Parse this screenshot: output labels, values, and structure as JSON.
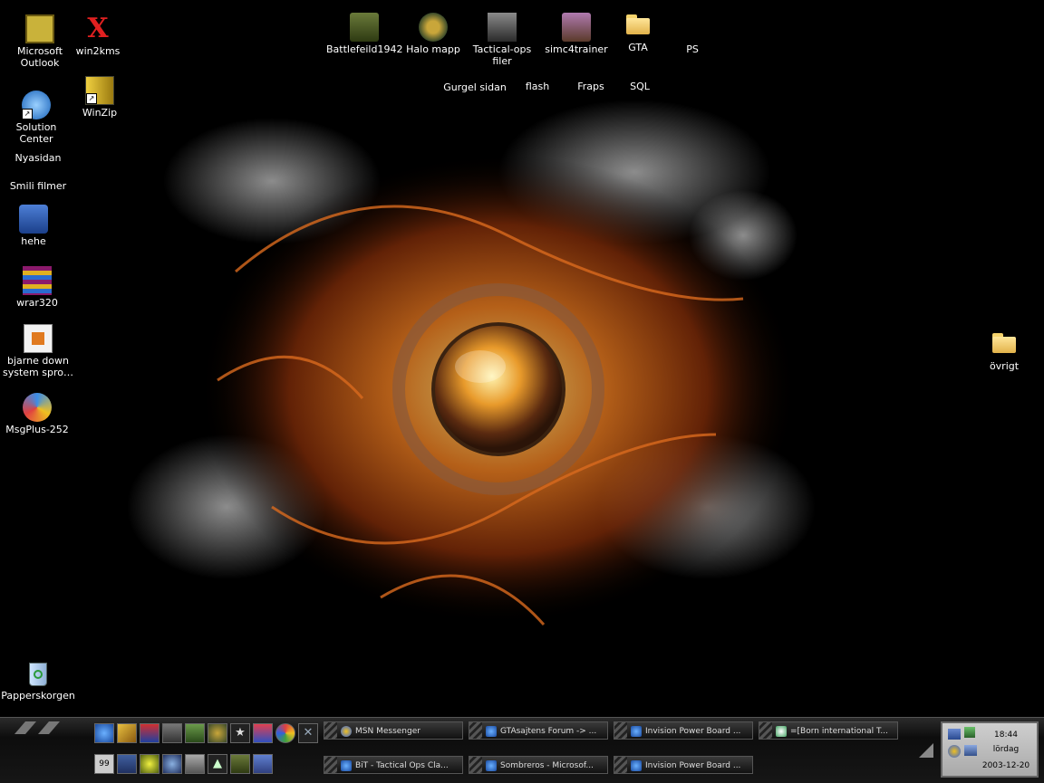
{
  "desktop": {
    "left_column": [
      {
        "label": "Microsoft Outlook",
        "icon": "outlook-icon"
      },
      {
        "label": "Solution Center",
        "icon": "dell-icon"
      },
      {
        "label": "Nyasidan",
        "icon": ""
      },
      {
        "label": "Smili filmer",
        "icon": ""
      },
      {
        "label": "hehe",
        "icon": "psd-icon"
      },
      {
        "label": "wrar320",
        "icon": "winrar-icon"
      },
      {
        "label": "bjarne down system spro…",
        "icon": "document-icon"
      },
      {
        "label": "MsgPlus-252",
        "icon": "msgplus-icon"
      }
    ],
    "second_column": [
      {
        "label": "win2kms",
        "icon": "x-icon"
      },
      {
        "label": "WinZip",
        "icon": "winzip-icon"
      }
    ],
    "top_row": [
      {
        "label": "Battlefeild1942",
        "icon": "battlefield-icon"
      },
      {
        "label": "Halo mapp",
        "icon": "halo-icon"
      },
      {
        "label": "Tactical-ops filer",
        "icon": "tactical-icon"
      },
      {
        "label": "simc4trainer",
        "icon": "trainer-icon"
      },
      {
        "label": "GTA",
        "icon": "folder-icon"
      },
      {
        "label": "PS",
        "icon": ""
      }
    ],
    "second_row": [
      {
        "label": "Gurgel sidan"
      },
      {
        "label": "flash"
      },
      {
        "label": "Fraps"
      },
      {
        "label": "SQL"
      }
    ],
    "recycle": {
      "label": "Papperskorgen"
    },
    "right_folder": {
      "label": "övrigt"
    }
  },
  "taskbar": {
    "tasks_row1": [
      "MSN Messenger",
      "GTAsajtens Forum -> ...",
      "Invision Power Board ...",
      "=[Born international T..."
    ],
    "tasks_row2": [
      "BiT - Tactical Ops Cla...",
      "Sombreros - Microsof...",
      "Invision Power Board ..."
    ],
    "tray": {
      "time": "18:44",
      "day": "lördag",
      "date": "2003-12-20"
    }
  }
}
